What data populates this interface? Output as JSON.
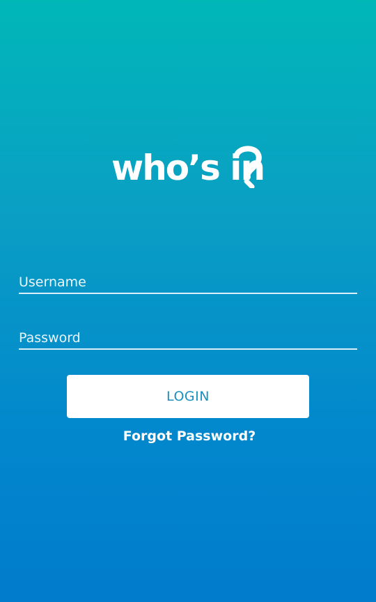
{
  "logo": {
    "text": "who’s in?",
    "main": "who’s in",
    "mark": "?"
  },
  "form": {
    "username": {
      "placeholder": "Username",
      "value": ""
    },
    "password": {
      "placeholder": "Password",
      "value": ""
    },
    "login_label": "LOGIN",
    "forgot_label": "Forgot Password?"
  },
  "colors": {
    "gradient_top": "#00b7b8",
    "gradient_bottom": "#017bcc",
    "button_bg": "#ffffff",
    "button_text": "#1a8fc0",
    "text": "#ffffff"
  }
}
